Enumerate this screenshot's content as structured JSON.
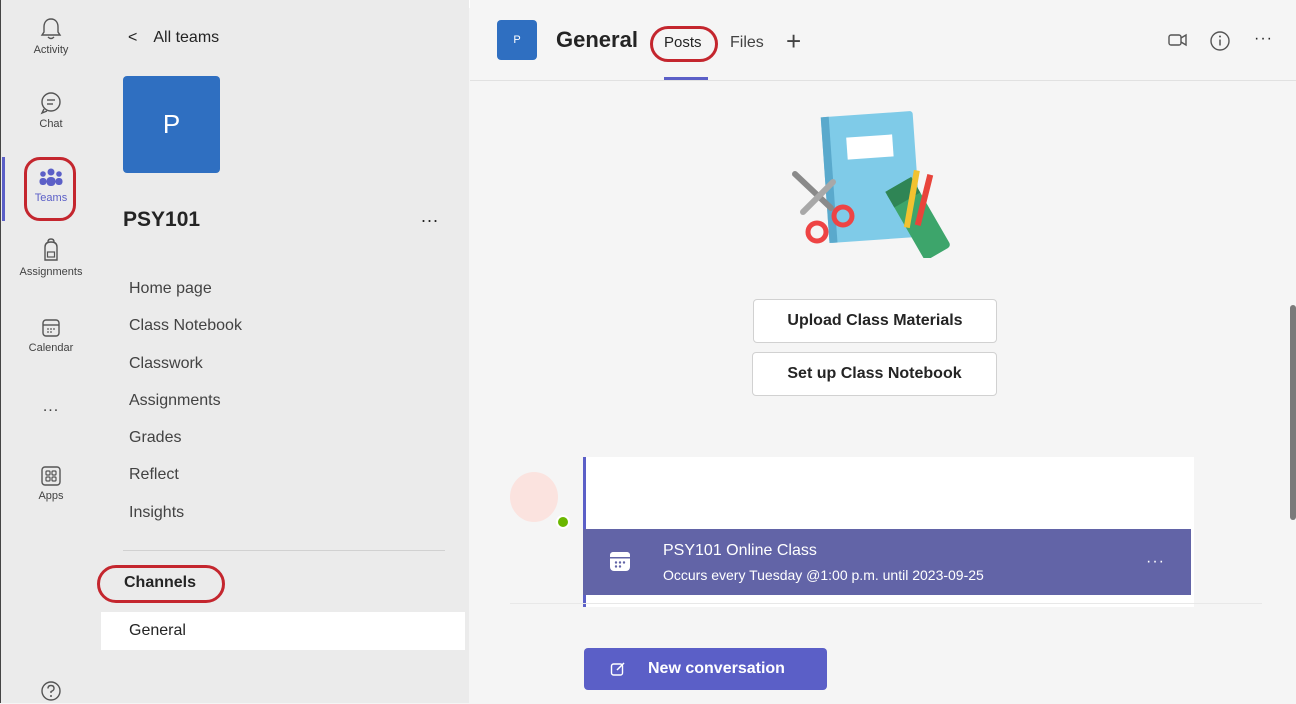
{
  "rail": {
    "items": [
      {
        "label": "Activity",
        "icon": "bell-icon"
      },
      {
        "label": "Chat",
        "icon": "chat-icon"
      },
      {
        "label": "Teams",
        "icon": "teams-icon"
      },
      {
        "label": "Assignments",
        "icon": "backpack-icon"
      },
      {
        "label": "Calendar",
        "icon": "calendar-icon"
      },
      {
        "label": "...",
        "icon": "more-icon"
      },
      {
        "label": "Apps",
        "icon": "apps-icon"
      }
    ],
    "help_icon": "help-icon"
  },
  "teampane": {
    "back_label": "All teams",
    "avatar_letter": "P",
    "team_name": "PSY101",
    "more": "...",
    "nav": [
      "Home page",
      "Class Notebook",
      "Classwork",
      "Assignments",
      "Grades",
      "Reflect",
      "Insights"
    ],
    "channels_label": "Channels",
    "channels": [
      "General"
    ]
  },
  "header": {
    "avatar_letter": "P",
    "title": "General",
    "tabs": {
      "posts": "Posts",
      "files": "Files",
      "add": "+"
    },
    "more": "···"
  },
  "main": {
    "upload_button": "Upload Class Materials",
    "notebook_button": "Set up Class Notebook",
    "event": {
      "title": "PSY101 Online Class",
      "subtitle": "Occurs every Tuesday @1:00 p.m. until 2023-09-25",
      "more": "···"
    },
    "new_conversation": "New conversation"
  },
  "colors": {
    "accent": "#5b5fc7",
    "event_banner": "#6264a7",
    "team_avatar": "#2f6fc1",
    "highlight": "#c4262e"
  }
}
